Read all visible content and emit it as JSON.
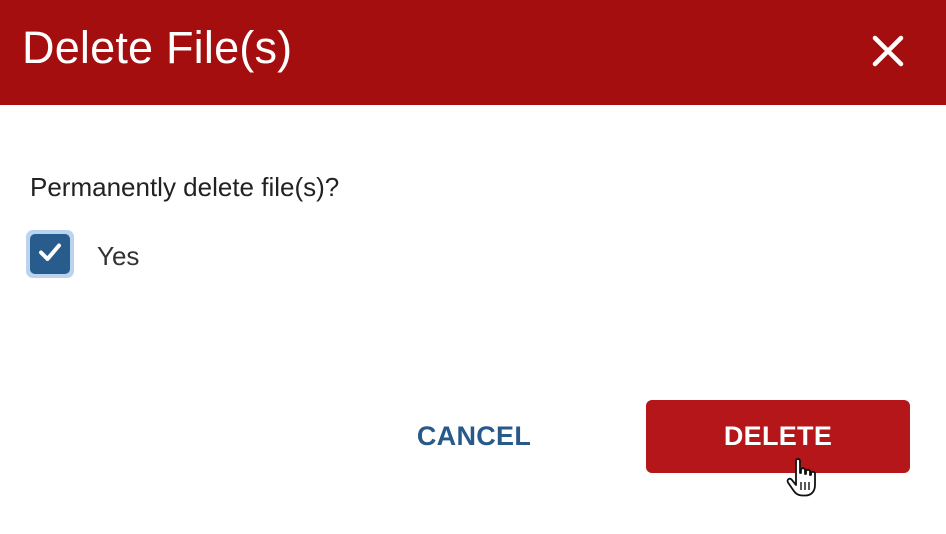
{
  "dialog": {
    "title": "Delete File(s)",
    "close_icon": "close-icon",
    "prompt": "Permanently delete file(s)?",
    "confirm_checkbox": {
      "label": "Yes",
      "checked": true,
      "icon": "checkmark-icon"
    },
    "cancel_label": "CANCEL",
    "delete_label": "DELETE"
  },
  "colors": {
    "header_bg": "#a50e0e",
    "delete_button_bg": "#b4161a",
    "cancel_text": "#275a8a",
    "checkbox_fill": "#285c8c",
    "checkbox_focus_ring": "#bcd3ee"
  },
  "pointer": {
    "icon": "hand-pointer-icon"
  }
}
